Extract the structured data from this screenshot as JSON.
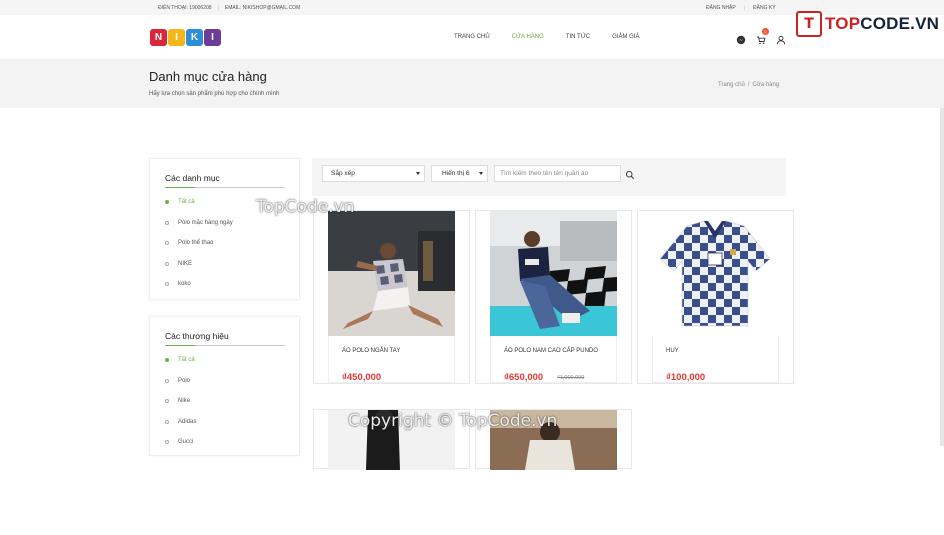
{
  "topbar": {
    "phone": "ĐIỆN THOẠI: 19006208",
    "email": "EMAIL: NIKISHOP@GMAIL.COM",
    "login": "ĐĂNG NHẬP",
    "register": "ĐĂNG KÝ"
  },
  "watermark_logo": {
    "prefix": "TOP",
    "rest": "CODE.VN"
  },
  "logo": {
    "letters": [
      "N",
      "I",
      "K",
      "I"
    ],
    "colors": [
      "#d9263a",
      "#f1b71c",
      "#2d8fd6",
      "#6c3c99"
    ]
  },
  "nav": {
    "items": [
      "TRANG CHỦ",
      "CỬA HÀNG",
      "TIN TỨC",
      "GIẢM GIÁ"
    ],
    "active": "CỬA HÀNG"
  },
  "cart": {
    "count": "0"
  },
  "banner": {
    "title": "Danh mục cửa hàng",
    "subtitle": "Hãy lựa chọn sản phẩm phù hợp cho chính mình",
    "breadcrumb": [
      "Trang chủ",
      "/",
      "Cửa hàng"
    ]
  },
  "categories": {
    "title": "Các danh mục",
    "items": [
      "Tất cả",
      "Polo mặc hàng ngày",
      "Polo thể thao",
      "NIKE",
      "koko"
    ],
    "selected": 0
  },
  "brands": {
    "title": "Các thương hiệu",
    "items": [
      "Tất cả",
      "Polo",
      "Nike",
      "Adidas",
      "Gucci"
    ],
    "selected": 0
  },
  "toolbar": {
    "sort_label": "Sắp xếp",
    "show_label": "Hiển thị 6",
    "search_placeholder": "Tìm kiếm theo tên tên quần áo"
  },
  "products": [
    {
      "name": "ÁO POLO NGẮN TAY",
      "price": "₫450,000",
      "old_price": ""
    },
    {
      "name": "ÁO POLO NAM CAO CẤP PUNDO",
      "price": "₫650,000",
      "old_price": "₫1,000,000"
    },
    {
      "name": "HUY",
      "price": "₫100,000",
      "old_price": ""
    }
  ],
  "watermarks": [
    "TopCode.vn",
    "Copyright © TopCode.vn"
  ],
  "colors": {
    "accent": "#6ab04c",
    "price": "#e53935"
  }
}
